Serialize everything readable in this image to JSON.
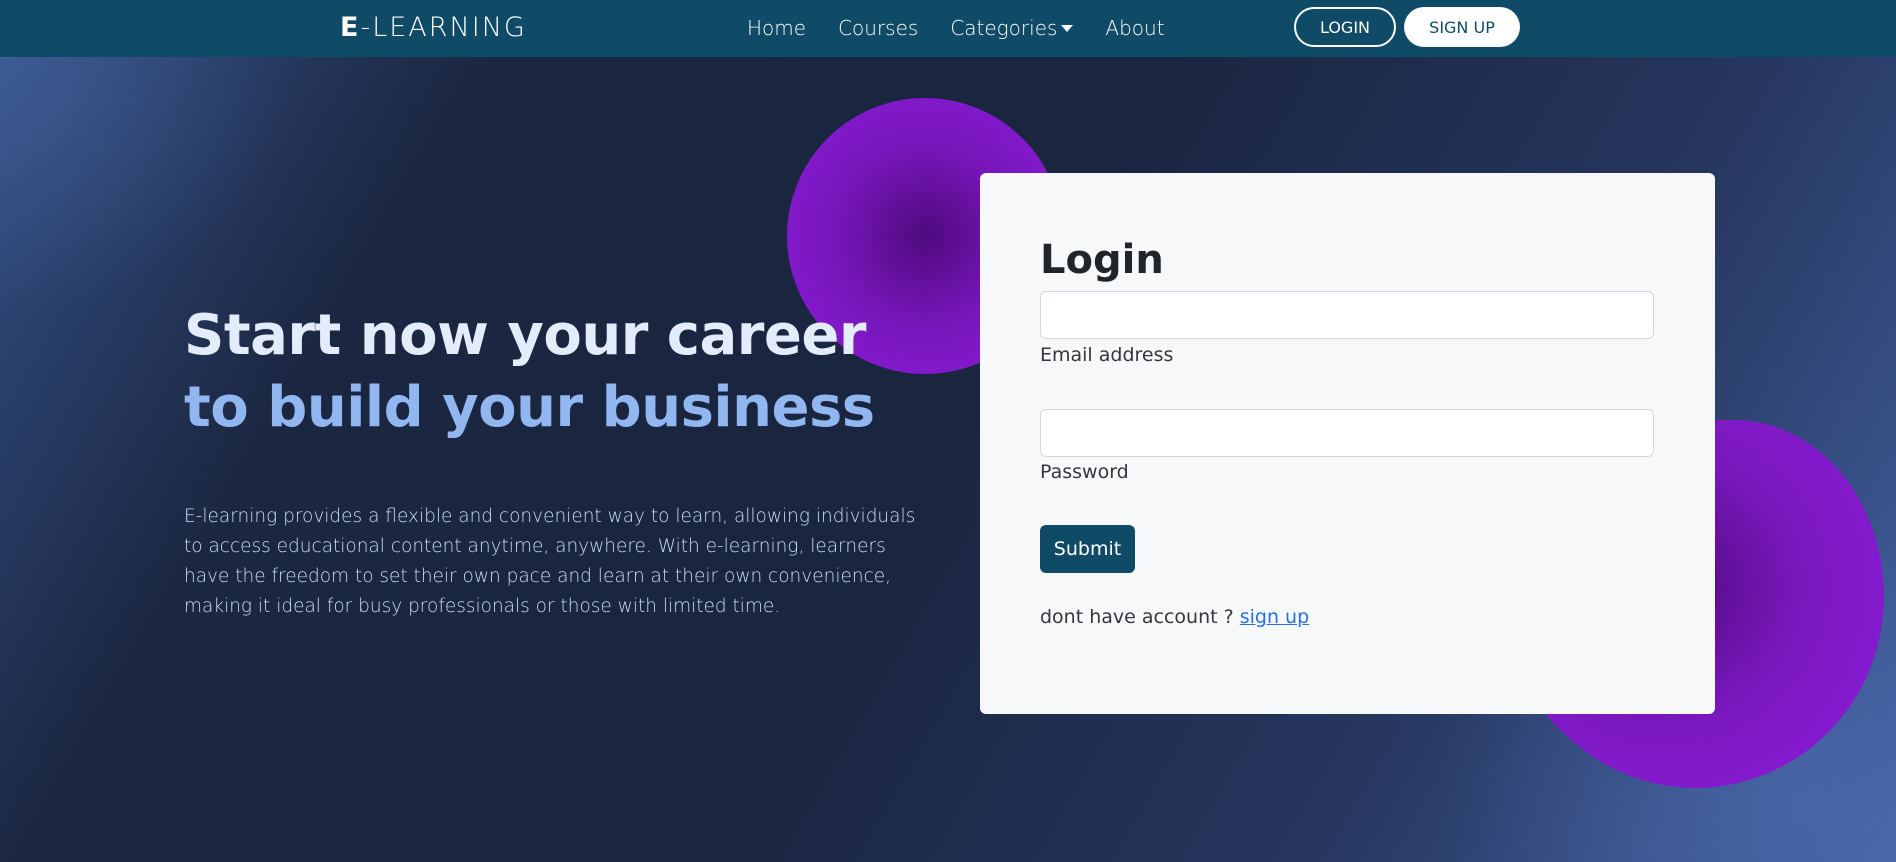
{
  "nav": {
    "brand_first": "E",
    "brand_rest": "-LEARNING",
    "links": [
      "Home",
      "Courses",
      "Categories",
      "About"
    ],
    "login_label": "LOGIN",
    "signup_label": "SIGN UP"
  },
  "hero": {
    "title_line1": "Start now your career",
    "title_line2": "to build your business",
    "description": "E-learning provides a flexible and convenient way to learn, allowing individuals to access educational content anytime, anywhere. With e-learning, learners have the freedom to set their own pace and learn at their own convenience, making it ideal for busy professionals or those with limited time."
  },
  "login_form": {
    "title": "Login",
    "email_label": "Email address",
    "email_value": "",
    "password_label": "Password",
    "password_value": "",
    "submit_label": "Submit",
    "no_account_text": "dont have account ? ",
    "signup_link": "sign up"
  },
  "colors": {
    "navbar": "#0f4a66",
    "accent_purple": "#8f1de0",
    "title_light": "#e3ecfb",
    "title_blue": "#91b6f0"
  }
}
